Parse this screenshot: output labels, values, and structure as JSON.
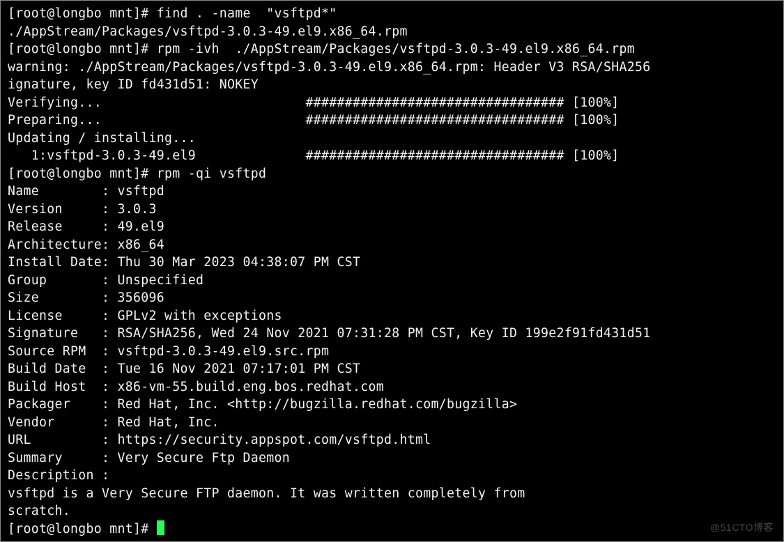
{
  "prompts": {
    "p1_prefix": "[root@longbo mnt]# ",
    "p1_cmd": "find . -name  \"vsftpd*\"",
    "p2_prefix": "[root@longbo mnt]# ",
    "p2_cmd": "rpm -ivh  ./AppStream/Packages/vsftpd-3.0.3-49.el9.x86_64.rpm",
    "p3_prefix": "[root@longbo mnt]# ",
    "p3_cmd": "rpm -qi vsftpd",
    "p4_prefix": "[root@longbo mnt]# "
  },
  "find_out": "./AppStream/Packages/vsftpd-3.0.3-49.el9.x86_64.rpm",
  "rpm_ivh": {
    "warn_l1": "warning: ./AppStream/Packages/vsftpd-3.0.3-49.el9.x86_64.rpm: Header V3 RSA/SHA256 ",
    "warn_l2": "ignature, key ID fd431d51: NOKEY",
    "verify": "Verifying...                          ################################# [100%]",
    "prepare": "Preparing...                          ################################# [100%]",
    "updating": "Updating / installing...",
    "pkgline": "   1:vsftpd-3.0.3-49.el9              ################################# [100%]"
  },
  "qi": {
    "name": "Name        : vsftpd",
    "version": "Version     : 3.0.3",
    "release": "Release     : 49.el9",
    "arch": "Architecture: x86_64",
    "install": "Install Date: Thu 30 Mar 2023 04:38:07 PM CST",
    "group": "Group       : Unspecified",
    "size": "Size        : 356096",
    "license": "License     : GPLv2 with exceptions",
    "signature": "Signature   : RSA/SHA256, Wed 24 Nov 2021 07:31:28 PM CST, Key ID 199e2f91fd431d51",
    "srcrpm": "Source RPM  : vsftpd-3.0.3-49.el9.src.rpm",
    "builddate": "Build Date  : Tue 16 Nov 2021 07:17:01 PM CST",
    "buildhost": "Build Host  : x86-vm-55.build.eng.bos.redhat.com",
    "packager": "Packager    : Red Hat, Inc. <http://bugzilla.redhat.com/bugzilla>",
    "vendor": "Vendor      : Red Hat, Inc.",
    "url": "URL         : https://security.appspot.com/vsftpd.html",
    "summary": "Summary     : Very Secure Ftp Daemon",
    "desc_hdr": "Description :",
    "desc_l1": "vsftpd is a Very Secure FTP daemon. It was written completely from",
    "desc_l2": "scratch."
  },
  "watermark": "@51CTO博客"
}
